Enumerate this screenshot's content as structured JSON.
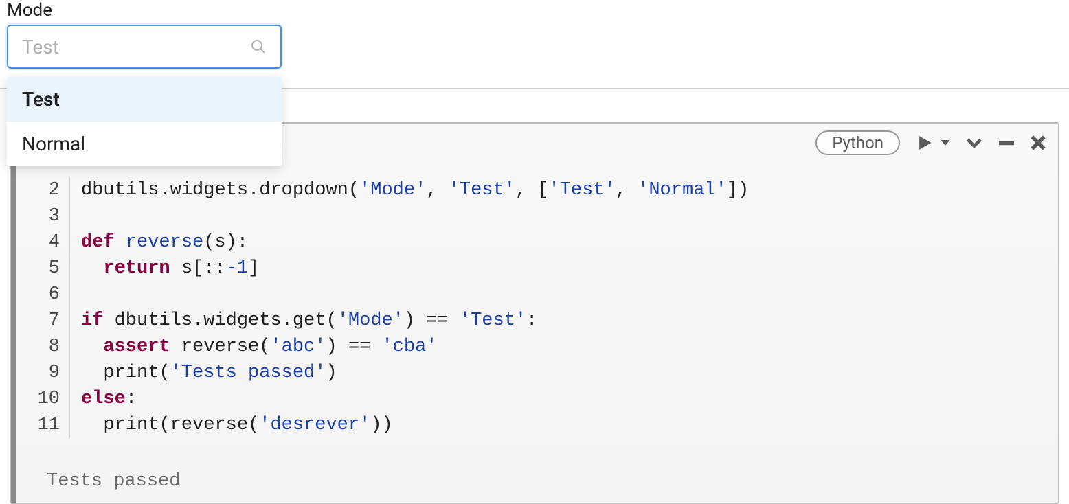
{
  "widget": {
    "label": "Mode",
    "placeholder": "Test",
    "options": [
      "Test",
      "Normal"
    ],
    "selected_index": 0
  },
  "cell": {
    "language_label": "Python",
    "line_start": 2,
    "lines": [
      {
        "n": 2,
        "tokens": [
          {
            "t": "dbutils.widgets.dropdown(",
            "c": "normal"
          },
          {
            "t": "'Mode'",
            "c": "str"
          },
          {
            "t": ", ",
            "c": "normal"
          },
          {
            "t": "'Test'",
            "c": "str"
          },
          {
            "t": ", [",
            "c": "normal"
          },
          {
            "t": "'Test'",
            "c": "str"
          },
          {
            "t": ", ",
            "c": "normal"
          },
          {
            "t": "'Normal'",
            "c": "str"
          },
          {
            "t": "])",
            "c": "normal"
          }
        ]
      },
      {
        "n": 3,
        "tokens": []
      },
      {
        "n": 4,
        "tokens": [
          {
            "t": "def",
            "c": "kw"
          },
          {
            "t": " ",
            "c": "normal"
          },
          {
            "t": "reverse",
            "c": "def"
          },
          {
            "t": "(s):",
            "c": "normal"
          }
        ]
      },
      {
        "n": 5,
        "tokens": [
          {
            "t": "  ",
            "c": "normal"
          },
          {
            "t": "return",
            "c": "kw"
          },
          {
            "t": " s[::",
            "c": "normal"
          },
          {
            "t": "-1",
            "c": "num"
          },
          {
            "t": "]",
            "c": "normal"
          }
        ]
      },
      {
        "n": 6,
        "tokens": []
      },
      {
        "n": 7,
        "tokens": [
          {
            "t": "if",
            "c": "kw"
          },
          {
            "t": " dbutils.widgets.get(",
            "c": "normal"
          },
          {
            "t": "'Mode'",
            "c": "str"
          },
          {
            "t": ") == ",
            "c": "normal"
          },
          {
            "t": "'Test'",
            "c": "str"
          },
          {
            "t": ":",
            "c": "normal"
          }
        ]
      },
      {
        "n": 8,
        "tokens": [
          {
            "t": "  ",
            "c": "normal"
          },
          {
            "t": "assert",
            "c": "kw"
          },
          {
            "t": " reverse(",
            "c": "normal"
          },
          {
            "t": "'abc'",
            "c": "str"
          },
          {
            "t": ") == ",
            "c": "normal"
          },
          {
            "t": "'cba'",
            "c": "str"
          }
        ]
      },
      {
        "n": 9,
        "tokens": [
          {
            "t": "  print(",
            "c": "normal"
          },
          {
            "t": "'Tests passed'",
            "c": "str"
          },
          {
            "t": ")",
            "c": "normal"
          }
        ]
      },
      {
        "n": 10,
        "tokens": [
          {
            "t": "else",
            "c": "kw"
          },
          {
            "t": ":",
            "c": "normal"
          }
        ]
      },
      {
        "n": 11,
        "tokens": [
          {
            "t": "  print(reverse(",
            "c": "normal"
          },
          {
            "t": "'desrever'",
            "c": "str"
          },
          {
            "t": "))",
            "c": "normal"
          }
        ]
      }
    ],
    "output": "Tests passed"
  }
}
